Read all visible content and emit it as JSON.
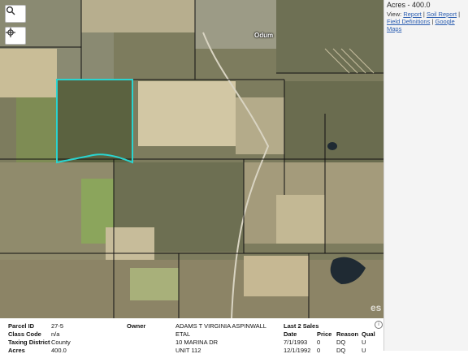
{
  "map": {
    "town_label": "Odum",
    "watermark": "es",
    "selected_outline_color": "#2ad4d0"
  },
  "controls": {
    "zoom_icon": "magnifier-icon",
    "locate_icon": "crosshair-icon"
  },
  "sidebar": {
    "acres_label": "Acres - 400.0",
    "view_prefix": "View:",
    "links": [
      "Report",
      "Soil Report",
      "Field Definitions",
      "Google Maps"
    ]
  },
  "parcel": {
    "labels": {
      "parcel_id": "Parcel ID",
      "class_code": "Class Code",
      "taxing_district": "Taxing District",
      "acres": "Acres",
      "owner": "Owner",
      "last_sales": "Last 2 Sales"
    },
    "values": {
      "parcel_id": "27-5",
      "class_code": "n/a",
      "taxing_district": "County",
      "acres": "400.0",
      "owner_line1": "ADAMS T VIRGINIA ASPINWALL",
      "owner_line2": "ETAL",
      "owner_line3": "10 MARINA DR",
      "owner_line4": "UNIT 112"
    },
    "sales_headers": [
      "Date",
      "Price",
      "Reason",
      "Qual"
    ],
    "sales": [
      {
        "date": "7/1/1993",
        "price": "0",
        "reason": "DQ",
        "qual": "U"
      },
      {
        "date": "12/1/1992",
        "price": "0",
        "reason": "DQ",
        "qual": "U"
      }
    ]
  }
}
